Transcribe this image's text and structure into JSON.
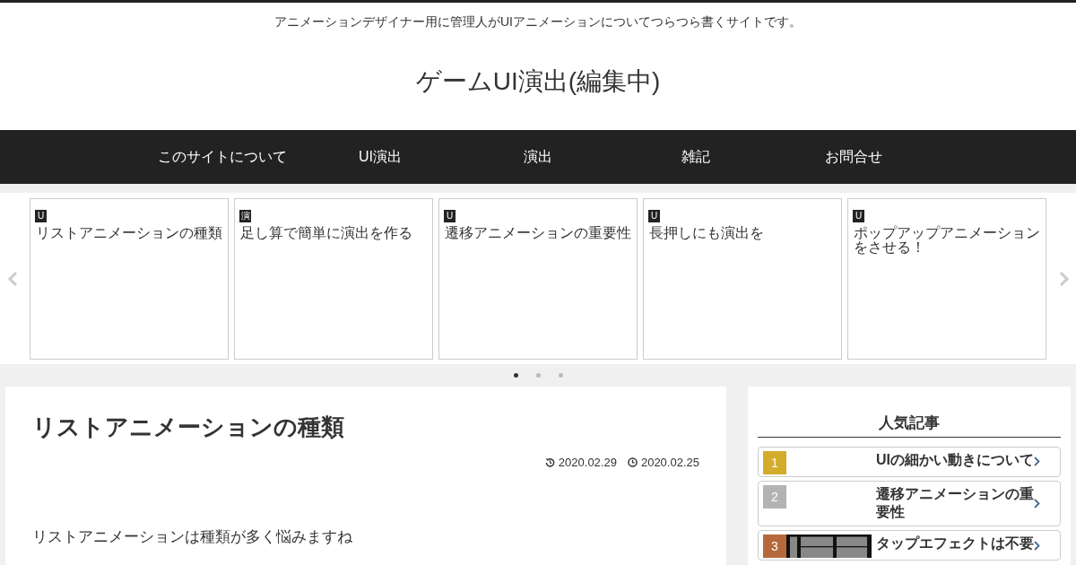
{
  "header": {
    "tagline": "アニメーションデザイナー用に管理人がUIアニメーションについてつらつら書くサイトです。",
    "site_title": "ゲームUI演出(編集中)"
  },
  "nav": {
    "items": [
      {
        "label": "このサイトについて"
      },
      {
        "label": "UI演出"
      },
      {
        "label": "演出"
      },
      {
        "label": "雑記"
      },
      {
        "label": "お問合せ"
      }
    ]
  },
  "carousel": {
    "cards": [
      {
        "tag": "U",
        "title": "リストアニメーションの種類"
      },
      {
        "tag": "演",
        "title": "足し算で簡単に演出を作る"
      },
      {
        "tag": "U",
        "title": "遷移アニメーションの重要性"
      },
      {
        "tag": "U",
        "title": "長押しにも演出を"
      },
      {
        "tag": "U",
        "title": "ポップアップアニメーションをさせる！"
      }
    ],
    "dots": [
      {
        "selected": true
      },
      {
        "selected": false
      },
      {
        "selected": false
      }
    ]
  },
  "article": {
    "title": "リストアニメーションの種類",
    "updated": "2020.02.29",
    "published": "2020.02.25",
    "body": "リストアニメーションは種類が多く悩みますね"
  },
  "sidebar": {
    "heading": "人気記事",
    "items": [
      {
        "rank": "1",
        "color": "#d4ac2b",
        "title": "UIの細かい動きについて",
        "thumbnail": false
      },
      {
        "rank": "2",
        "color": "#b3b3b3",
        "title": "遷移アニメーションの重要性",
        "thumbnail": false
      },
      {
        "rank": "3",
        "color": "#b5693a",
        "title": "タップエフェクトは不要",
        "thumbnail": true
      }
    ]
  }
}
